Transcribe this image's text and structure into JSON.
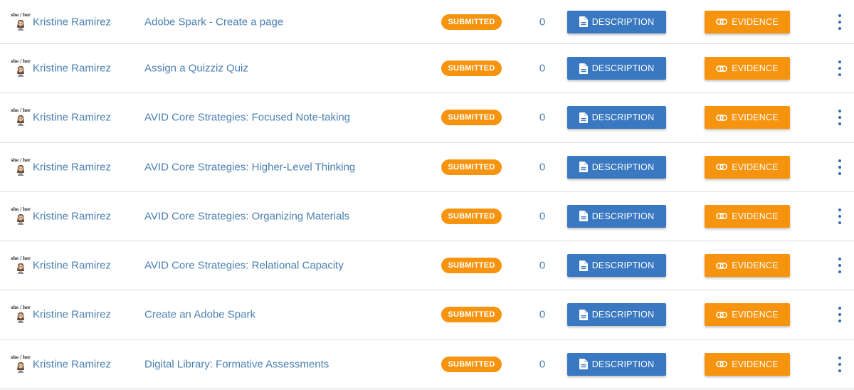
{
  "colors": {
    "link": "#4a7fb1",
    "status_bg": "#f7940f",
    "description_btn": "#3a78c2",
    "evidence_btn": "#f7940f",
    "kebab": "#2f6bb0"
  },
  "rows": [
    {
      "avatar_text": "she / her",
      "name": "Kristine Ramirez",
      "task": "Adobe Spark - Create a page",
      "status": "SUBMITTED",
      "count": "0",
      "description_label": "DESCRIPTION",
      "evidence_label": "EVIDENCE",
      "description_icon": "document-icon",
      "evidence_icon": "link-icon",
      "menu_icon": "more-vert-icon"
    },
    {
      "avatar_text": "she / her",
      "name": "Kristine Ramirez",
      "task": "Assign a Quizziz Quiz",
      "status": "SUBMITTED",
      "count": "0",
      "description_label": "DESCRIPTION",
      "evidence_label": "EVIDENCE",
      "description_icon": "document-icon",
      "evidence_icon": "link-icon",
      "menu_icon": "more-vert-icon"
    },
    {
      "avatar_text": "she / her",
      "name": "Kristine Ramirez",
      "task": "AVID Core Strategies: Focused Note-taking",
      "status": "SUBMITTED",
      "count": "0",
      "description_label": "DESCRIPTION",
      "evidence_label": "EVIDENCE",
      "description_icon": "document-icon",
      "evidence_icon": "link-icon",
      "menu_icon": "more-vert-icon"
    },
    {
      "avatar_text": "she / her",
      "name": "Kristine Ramirez",
      "task": "AVID Core Strategies: Higher-Level Thinking",
      "status": "SUBMITTED",
      "count": "0",
      "description_label": "DESCRIPTION",
      "evidence_label": "EVIDENCE",
      "description_icon": "document-icon",
      "evidence_icon": "link-icon",
      "menu_icon": "more-vert-icon"
    },
    {
      "avatar_text": "she / her",
      "name": "Kristine Ramirez",
      "task": "AVID Core Strategies: Organizing Materials",
      "status": "SUBMITTED",
      "count": "0",
      "description_label": "DESCRIPTION",
      "evidence_label": "EVIDENCE",
      "description_icon": "document-icon",
      "evidence_icon": "link-icon",
      "menu_icon": "more-vert-icon"
    },
    {
      "avatar_text": "she / her",
      "name": "Kristine Ramirez",
      "task": "AVID Core Strategies: Relational Capacity",
      "status": "SUBMITTED",
      "count": "0",
      "description_label": "DESCRIPTION",
      "evidence_label": "EVIDENCE",
      "description_icon": "document-icon",
      "evidence_icon": "link-icon",
      "menu_icon": "more-vert-icon"
    },
    {
      "avatar_text": "she / her",
      "name": "Kristine Ramirez",
      "task": "Create an Adobe Spark",
      "status": "SUBMITTED",
      "count": "0",
      "description_label": "DESCRIPTION",
      "evidence_label": "EVIDENCE",
      "description_icon": "document-icon",
      "evidence_icon": "link-icon",
      "menu_icon": "more-vert-icon"
    },
    {
      "avatar_text": "she / her",
      "name": "Kristine Ramirez",
      "task": "Digital Library: Formative Assessments",
      "status": "SUBMITTED",
      "count": "0",
      "description_label": "DESCRIPTION",
      "evidence_label": "EVIDENCE",
      "description_icon": "document-icon",
      "evidence_icon": "link-icon",
      "menu_icon": "more-vert-icon"
    }
  ]
}
